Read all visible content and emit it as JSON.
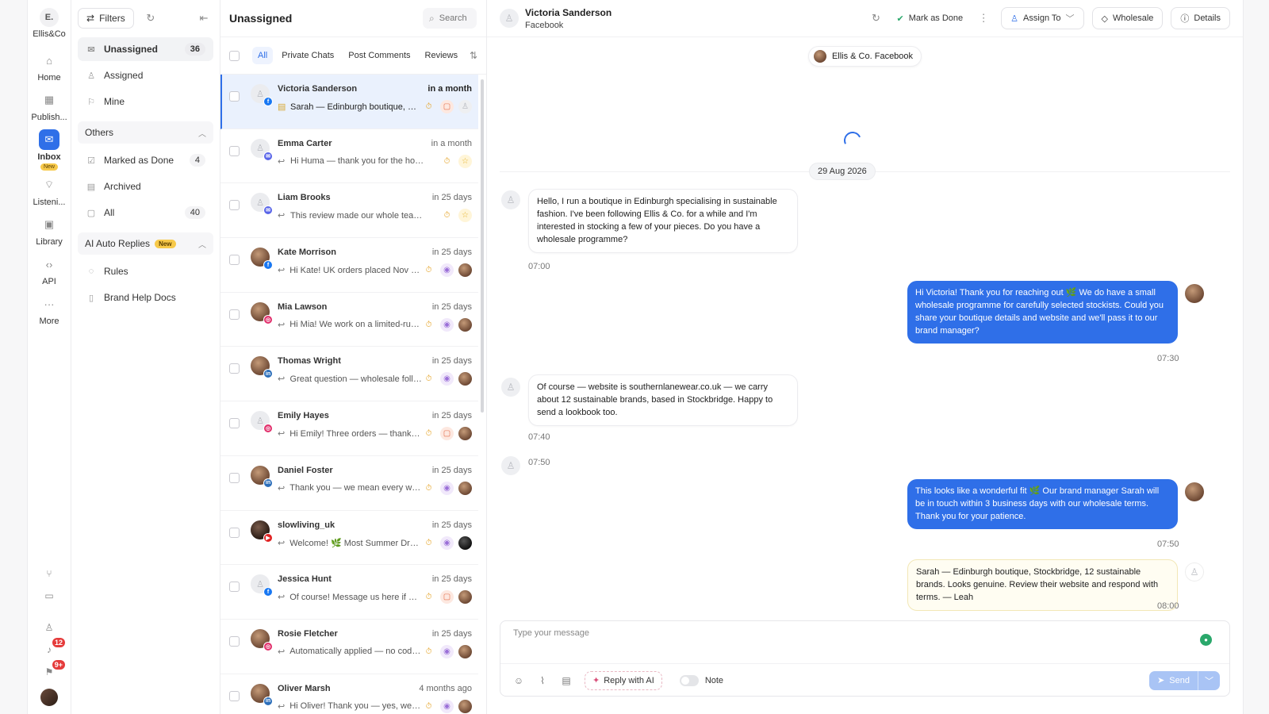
{
  "rail": {
    "brand_initial": "E.",
    "brand_name": "Ellis&Co",
    "items": [
      {
        "label": "Home",
        "icon": "home-icon"
      },
      {
        "label": "Publish...",
        "icon": "calendar-icon"
      },
      {
        "label": "Inbox",
        "icon": "inbox-icon",
        "badge": "New"
      },
      {
        "label": "Listeni...",
        "icon": "rss-icon"
      },
      {
        "label": "Library",
        "icon": "image-icon"
      },
      {
        "label": "API",
        "icon": "code-icon"
      },
      {
        "label": "More",
        "icon": "more-icon"
      }
    ],
    "notifications_count": "12",
    "messages_count": "9+"
  },
  "folders": {
    "filters_label": "Filters",
    "main": [
      {
        "label": "Unassigned",
        "count": "36"
      },
      {
        "label": "Assigned",
        "count": ""
      },
      {
        "label": "Mine",
        "count": ""
      }
    ],
    "others_label": "Others",
    "others": [
      {
        "label": "Marked as Done",
        "count": "4"
      },
      {
        "label": "Archived",
        "count": ""
      },
      {
        "label": "All",
        "count": "40"
      }
    ],
    "ai_label": "AI Auto Replies",
    "ai_badge": "New",
    "ai_items": [
      {
        "label": "Rules"
      },
      {
        "label": "Brand Help Docs"
      }
    ]
  },
  "list": {
    "title": "Unassigned",
    "search_placeholder": "Search",
    "tabs": [
      "All",
      "Private Chats",
      "Post Comments",
      "Reviews"
    ],
    "conversations": [
      {
        "name": "Victoria Sanderson",
        "time": "in a month",
        "preview": "Sarah — Edinburgh boutique, Stockbridge, 12 sustainable brands.",
        "platform": "facebook",
        "avatar": "default",
        "kind": "note",
        "badges": [
          "timer",
          "chat",
          "person"
        ]
      },
      {
        "name": "Emma Carter",
        "time": "in a month",
        "preview": "Hi Huma — thank you for the honest feedback.",
        "platform": "messenger",
        "avatar": "default",
        "kind": "reply",
        "badges": [
          "timer",
          "star"
        ]
      },
      {
        "name": "Liam Brooks",
        "time": "in 25 days",
        "preview": "This review made our whole team smile!",
        "platform": "messenger",
        "avatar": "default",
        "kind": "reply",
        "badges": [
          "timer",
          "star"
        ]
      },
      {
        "name": "Kate Morrison",
        "time": "in 25 days",
        "preview": "Hi Kate! UK orders placed Nov 28 through",
        "platform": "facebook",
        "avatar": "photo",
        "kind": "reply",
        "badges": [
          "timer",
          "eye",
          "photo"
        ]
      },
      {
        "name": "Mia Lawson",
        "time": "in 25 days",
        "preview": "Hi Mia! We work on a limited-run model",
        "platform": "instagram",
        "avatar": "photo",
        "kind": "reply",
        "badges": [
          "timer",
          "eye",
          "photo"
        ]
      },
      {
        "name": "Thomas Wright",
        "time": "in 25 days",
        "preview": "Great question — wholesale follows",
        "platform": "linkedin",
        "avatar": "photo",
        "kind": "reply",
        "badges": [
          "timer",
          "eye",
          "photo"
        ]
      },
      {
        "name": "Emily Hayes",
        "time": "in 25 days",
        "preview": "Hi Emily! Three orders — thank you, truly",
        "platform": "instagram",
        "avatar": "default",
        "kind": "reply",
        "badges": [
          "timer",
          "chat",
          "photo"
        ]
      },
      {
        "name": "Daniel Foster",
        "time": "in 25 days",
        "preview": "Thank you — we mean every word of it",
        "platform": "linkedin",
        "avatar": "photo",
        "kind": "reply",
        "badges": [
          "timer",
          "eye",
          "photo"
        ]
      },
      {
        "name": "slowliving_uk",
        "time": "in 25 days",
        "preview": "Welcome! 🌿 Most Summer Drop pieces",
        "platform": "youtube",
        "avatar": "dark",
        "kind": "reply",
        "badges": [
          "timer",
          "eye",
          "dark"
        ]
      },
      {
        "name": "Jessica Hunt",
        "time": "in 25 days",
        "preview": "Of course! Message us here if anything",
        "platform": "facebook",
        "avatar": "default",
        "kind": "reply",
        "badges": [
          "timer",
          "chat",
          "photo"
        ]
      },
      {
        "name": "Rosie Fletcher",
        "time": "in 25 days",
        "preview": "Automatically applied — no code needed",
        "platform": "instagram",
        "avatar": "photo",
        "kind": "reply",
        "badges": [
          "timer",
          "eye",
          "photo"
        ]
      },
      {
        "name": "Oliver Marsh",
        "time": "4 months ago",
        "preview": "Hi Oliver! Thank you — yes, we'd be happy",
        "platform": "linkedin",
        "avatar": "photo",
        "kind": "reply",
        "badges": [
          "timer",
          "eye",
          "photo"
        ]
      }
    ]
  },
  "chat": {
    "contact_name": "Victoria Sanderson",
    "contact_source": "Facebook",
    "mark_done_label": "Mark as Done",
    "assign_label": "Assign To",
    "tag_label": "Wholesale",
    "details_label": "Details",
    "channel_label": "Ellis & Co. Facebook",
    "date_label": "29 Aug 2026",
    "messages": [
      {
        "direction": "in",
        "text": "Hello, I run a boutique in Edinburgh specialising in sustainable fashion. I've been following Ellis & Co. for a while and I'm interested in stocking a few of your pieces. Do you have a wholesale programme?",
        "time": "07:00"
      },
      {
        "direction": "out",
        "text": "Hi Victoria! Thank you for reaching out 🌿 We do have a small wholesale programme for carefully selected stockists. Could you share your boutique details and website and we'll pass it to our brand manager?",
        "time": "07:30"
      },
      {
        "direction": "in",
        "text": "Of course — website is southernlanewear.co.uk — we carry about 12 sustainable brands, based in Stockbridge. Happy to send a lookbook too.",
        "time": "07:40"
      },
      {
        "direction": "in-empty",
        "text": "",
        "time": "07:50"
      },
      {
        "direction": "out",
        "text": "This looks like a wonderful fit 🌿 Our brand manager Sarah will be in touch within 3 business days with our wholesale terms. Thank you for your patience.",
        "time": "07:50"
      },
      {
        "direction": "note",
        "text": "Sarah — Edinburgh boutique, Stockbridge, 12 sustainable brands. Looks genuine. Review their website and respond with terms. — Leah",
        "time": "08:00"
      }
    ],
    "composer_placeholder": "Type your message",
    "reply_ai_label": "Reply with AI",
    "note_label": "Note",
    "send_label": "Send"
  },
  "colors": {
    "accent": "#2f6fe8",
    "note_bg": "#fffdf2",
    "new_badge": "#f7c94a"
  }
}
